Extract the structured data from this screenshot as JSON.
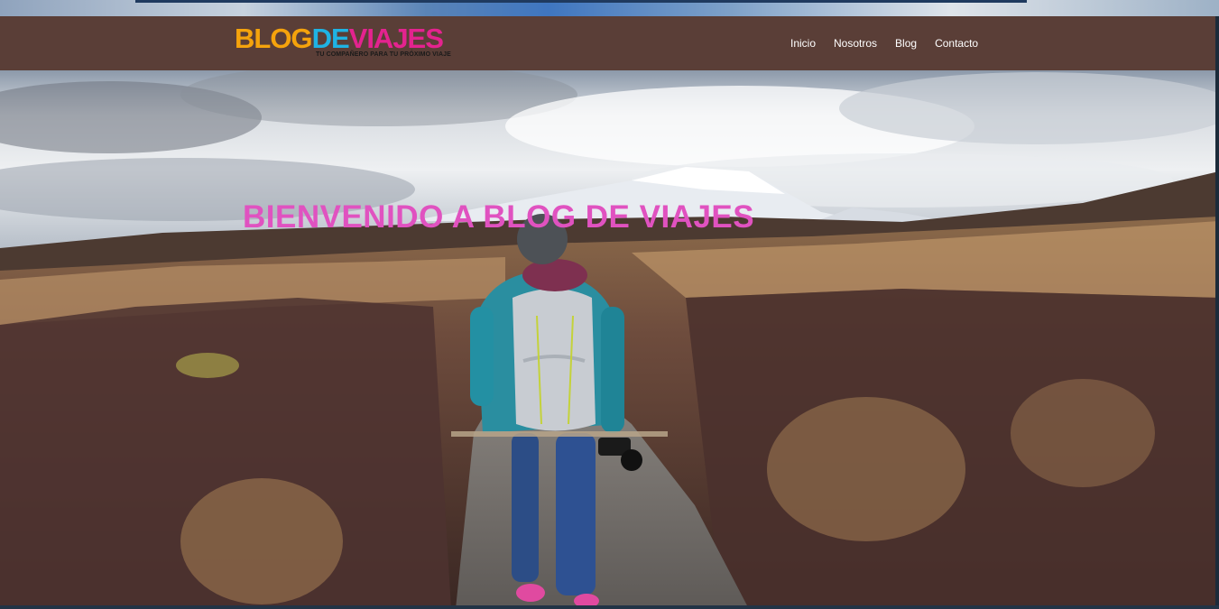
{
  "header": {
    "logo": {
      "part_blog": "BLOG",
      "part_de": "DE",
      "part_viajes": "VIAJES",
      "tagline": "TU COMPAÑERO PARA TU PRÓXIMO VIAJE"
    },
    "nav": [
      {
        "label": "Inicio"
      },
      {
        "label": "Nosotros"
      },
      {
        "label": "Blog"
      },
      {
        "label": "Contacto"
      }
    ]
  },
  "hero": {
    "title": "BIENVENIDO A BLOG DE VIAJES",
    "image_icon": "hiker-landscape-photo"
  },
  "colors": {
    "header_bg": "#5a3e37",
    "logo_blog": "#f5a30c",
    "logo_de": "#1fb3e3",
    "logo_viajes": "#e4238f",
    "hero_title": "#e052c0",
    "nav_text": "#ffffff"
  }
}
